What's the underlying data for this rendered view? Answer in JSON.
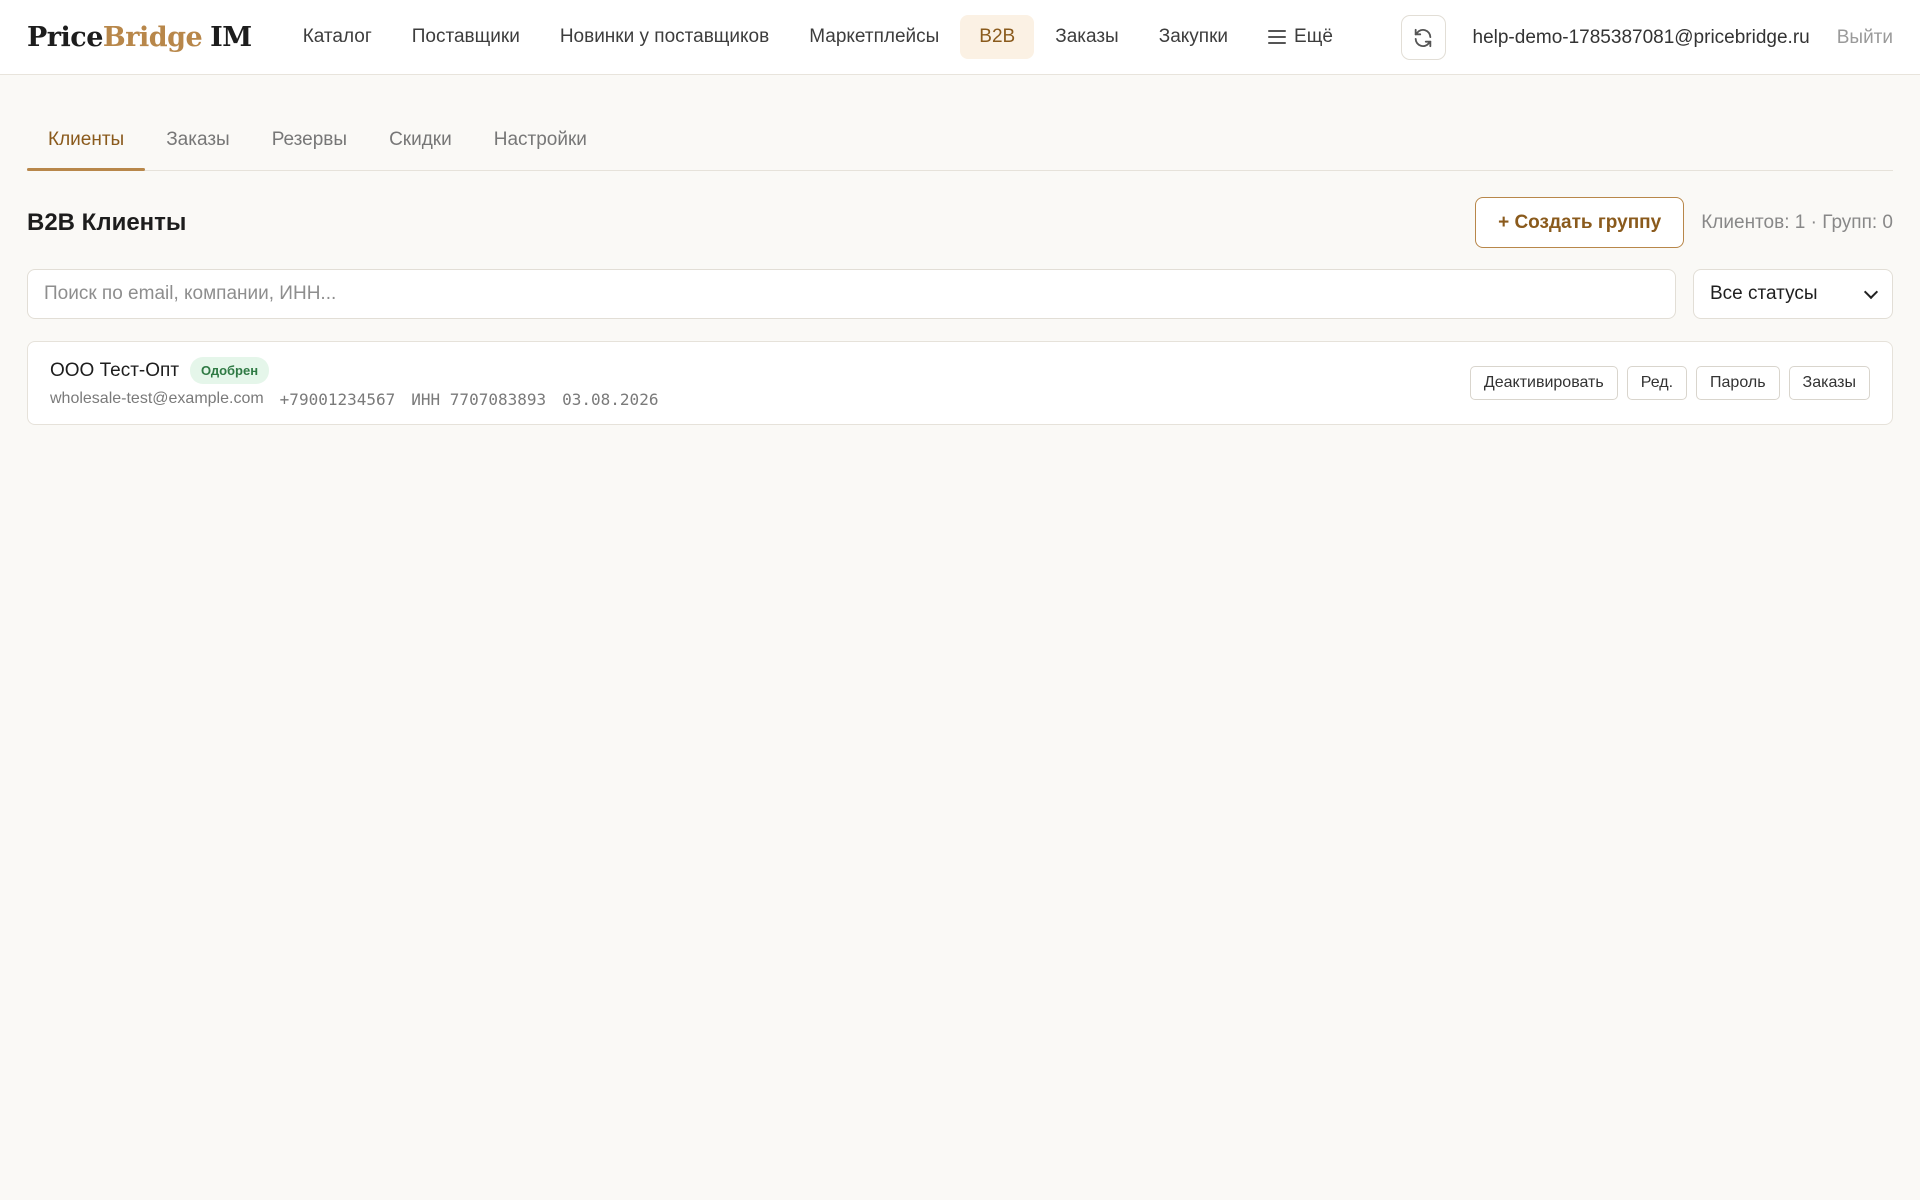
{
  "brand": {
    "part1": "Price",
    "part2": "Bridge",
    "part3": "IM"
  },
  "nav": {
    "items": [
      {
        "label": "Каталог"
      },
      {
        "label": "Поставщики"
      },
      {
        "label": "Новинки у поставщиков"
      },
      {
        "label": "Маркетплейсы"
      },
      {
        "label": "B2B"
      },
      {
        "label": "Заказы"
      },
      {
        "label": "Закупки"
      },
      {
        "label": "Ещё"
      }
    ],
    "active": "B2B"
  },
  "user": {
    "email": "help-demo-1785387081@pricebridge.ru",
    "logout_label": "Выйти"
  },
  "tabs": {
    "items": [
      {
        "label": "Клиенты"
      },
      {
        "label": "Заказы"
      },
      {
        "label": "Резервы"
      },
      {
        "label": "Скидки"
      },
      {
        "label": "Настройки"
      }
    ],
    "active": "Клиенты"
  },
  "page": {
    "title": "B2B Клиенты",
    "create_group_label": "+ Создать группу",
    "counts": "Клиентов: 1 · Групп: 0"
  },
  "filters": {
    "search_placeholder": "Поиск по email, компании, ИНН...",
    "status_selected": "Все статусы"
  },
  "clients": [
    {
      "name": "ООО Тест-Опт",
      "status": "Одобрен",
      "email": "wholesale-test@example.com",
      "phone": "+79001234567",
      "inn": "ИНН 7707083893",
      "date": "03.08.2026",
      "actions": {
        "deactivate": "Деактивировать",
        "edit": "Ред.",
        "password": "Пароль",
        "orders": "Заказы"
      }
    }
  ],
  "colors": {
    "accent": "#b8874a",
    "accent_text": "#8a5a1c",
    "active_bg": "#fbf1e4",
    "badge_bg": "#e5f6ea",
    "badge_text": "#2f7a44",
    "page_bg": "#faf9f6"
  },
  "icons": {
    "refresh": "refresh-icon",
    "menu": "menu-icon",
    "select": "chevron-down-icon"
  }
}
